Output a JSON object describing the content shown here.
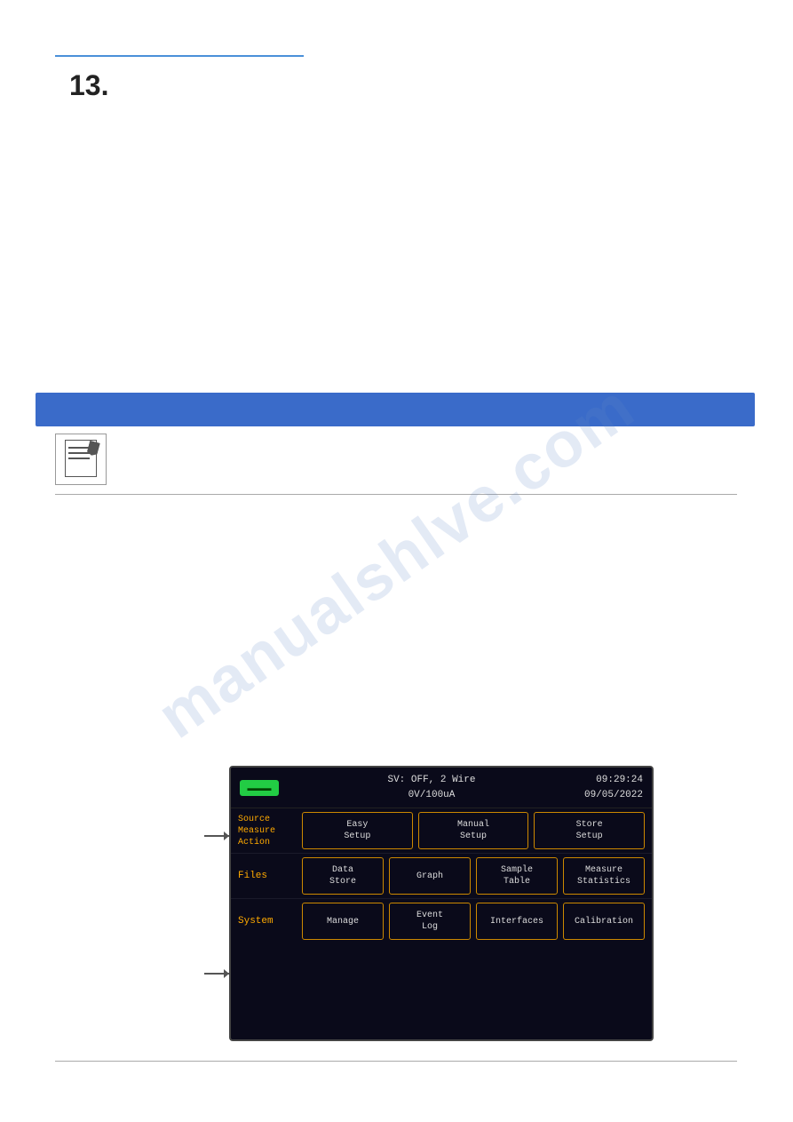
{
  "chapter": {
    "number": "13."
  },
  "watermark": {
    "text": "manualshlve.com"
  },
  "device": {
    "power_button_label": "",
    "header": {
      "center_line1": "SV: OFF, 2 Wire",
      "center_line2": "0V/100uA",
      "time": "09:29:24",
      "date": "09/05/2022"
    },
    "rows": [
      {
        "label": "Source\nMeasure\nAction",
        "buttons": [
          {
            "line1": "Easy",
            "line2": "Setup"
          },
          {
            "line1": "Manual",
            "line2": "Setup"
          },
          {
            "line1": "Store",
            "line2": "Setup"
          }
        ]
      },
      {
        "label": "Files",
        "buttons": [
          {
            "line1": "Data",
            "line2": "Store"
          },
          {
            "line1": "Graph",
            "line2": ""
          },
          {
            "line1": "Sample",
            "line2": "Table"
          },
          {
            "line1": "Measure",
            "line2": "Statistics"
          }
        ]
      },
      {
        "label": "System",
        "buttons": [
          {
            "line1": "Manage",
            "line2": ""
          },
          {
            "line1": "Event",
            "line2": "Log"
          },
          {
            "line1": "Interfaces",
            "line2": ""
          },
          {
            "line1": "Calibration",
            "line2": ""
          }
        ]
      }
    ]
  }
}
